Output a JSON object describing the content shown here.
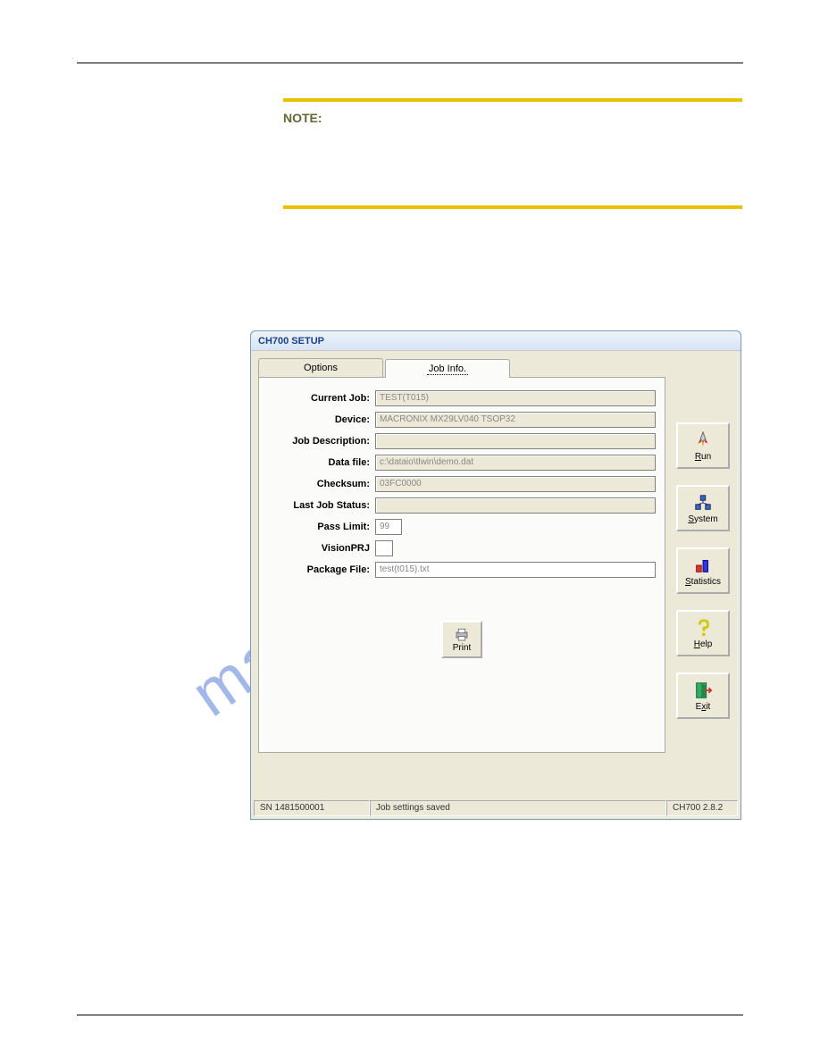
{
  "note_label": "NOTE:",
  "watermark": "manualshive.com",
  "dialog": {
    "title": "CH700 SETUP",
    "tab_options": "Options",
    "tab_jobinfo": "Job Info.",
    "fields": {
      "current_job_label": "Current Job:",
      "current_job": "TEST(T015)",
      "device_label": "Device:",
      "device": "MACRONIX MX29LV040 TSOP32",
      "job_description_label": "Job Description:",
      "job_description": "",
      "data_file_label": "Data file:",
      "data_file": "c:\\dataio\\tlwin\\demo.dat",
      "checksum_label": "Checksum:",
      "checksum": "03FC0000",
      "last_status_label": "Last Job Status:",
      "last_status": "",
      "pass_limit_label": "Pass Limit:",
      "pass_limit": "99",
      "vision_label": "VisionPRJ",
      "package_label": "Package File:",
      "package": "test(t015).txt"
    },
    "print_label": "Print",
    "side": {
      "run": "Run",
      "system": "System",
      "statistics": "Statistics",
      "help": "Help",
      "exit": "Exit"
    },
    "status": {
      "sn": "SN 1481500001",
      "msg": "Job settings saved",
      "ver": "CH700 2.8.2"
    }
  }
}
